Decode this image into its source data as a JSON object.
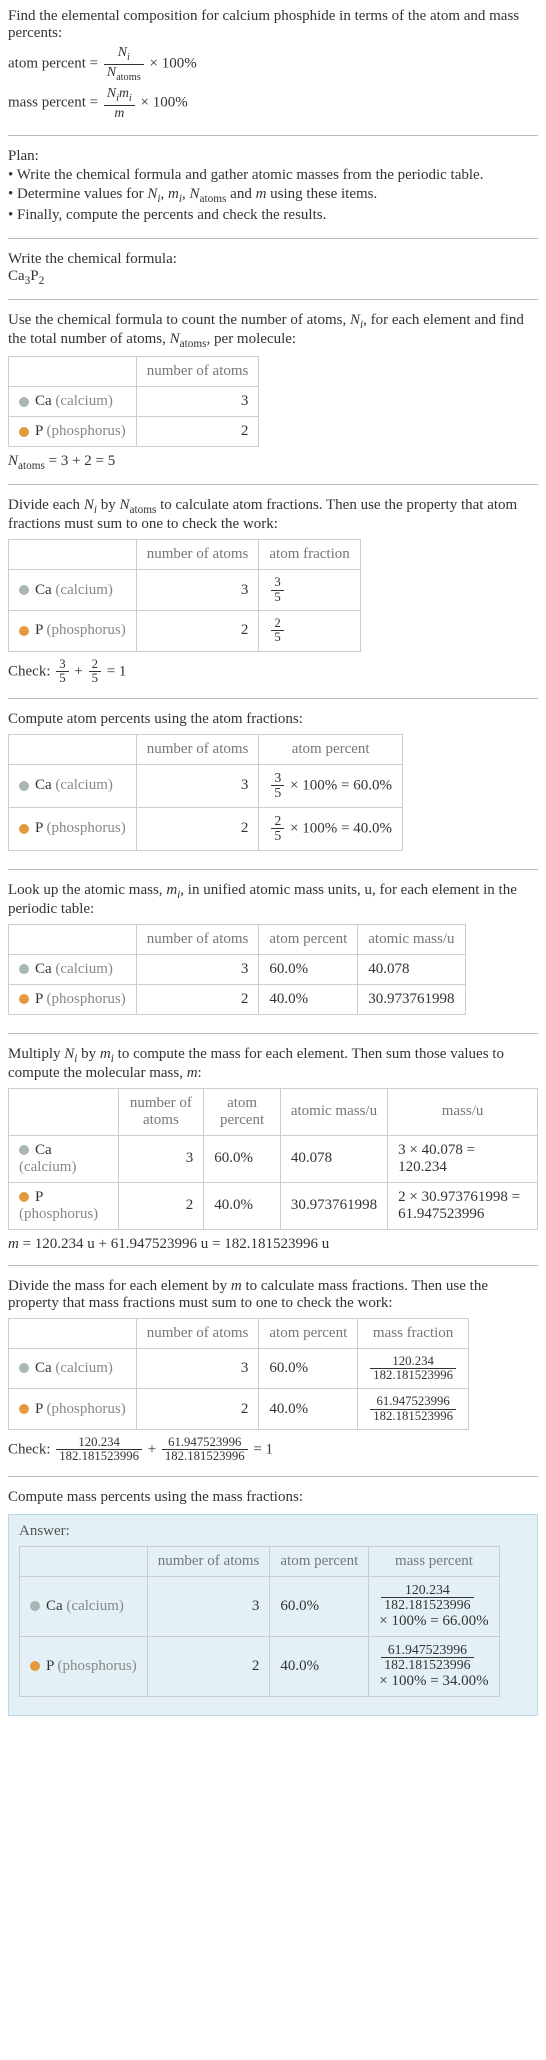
{
  "intro": {
    "line1": "Find the elemental composition for calcium phosphide in terms of the atom and mass percents:",
    "atom_percent_label": "atom percent",
    "mass_percent_label": "mass percent",
    "eq": " = ",
    "times100": " × 100%",
    "Ni": "N",
    "i": "i",
    "Natoms": "N",
    "atoms": "atoms",
    "mi": "m",
    "m": "m"
  },
  "plan": {
    "heading": "Plan:",
    "items": [
      "• Write the chemical formula and gather atomic masses from the periodic table.",
      "• Determine values for Nᵢ, mᵢ, N₍atoms₎ and m using these items.",
      "• Finally, compute the percents and check the results."
    ],
    "item2_pre": "• Determine values for ",
    "item2_mid1": ", ",
    "item2_mid2": ", ",
    "item2_mid3": " and ",
    "item2_post": " using these items."
  },
  "formula": {
    "heading": "Write the chemical formula:",
    "ca": "Ca",
    "ca_sub": "3",
    "p": "P",
    "p_sub": "2"
  },
  "count": {
    "text_pre": "Use the chemical formula to count the number of atoms, ",
    "text_mid": ", for each element and find the total number of atoms, ",
    "text_post": ", per molecule:",
    "col_num": "number of atoms",
    "ca_label": "Ca",
    "ca_paren": " (calcium)",
    "ca_n": "3",
    "p_label": "P",
    "p_paren": " (phosphorus)",
    "p_n": "2",
    "sum": " = 3 + 2 = 5"
  },
  "atomfrac": {
    "text_pre": "Divide each ",
    "text_mid": " by ",
    "text_post": " to calculate atom fractions. Then use the property that atom fractions must sum to one to check the work:",
    "col_num": "number of atoms",
    "col_frac": "atom fraction",
    "ca_n": "3",
    "ca_num": "3",
    "ca_den": "5",
    "p_n": "2",
    "p_num": "2",
    "p_den": "5",
    "check_pre": "Check: ",
    "check_mid": " + ",
    "check_post": " = 1"
  },
  "atompct": {
    "heading": "Compute atom percents using the atom fractions:",
    "col_num": "number of atoms",
    "col_pct": "atom percent",
    "ca_n": "3",
    "ca_expr_num": "3",
    "ca_expr_den": "5",
    "ca_expr_post": " × 100% = 60.0%",
    "p_n": "2",
    "p_expr_num": "2",
    "p_expr_den": "5",
    "p_expr_post": " × 100% = 40.0%"
  },
  "atomicmass": {
    "text_pre": "Look up the atomic mass, ",
    "text_post": ", in unified atomic mass units, u, for each element in the periodic table:",
    "col_num": "number of atoms",
    "col_pct": "atom percent",
    "col_mass": "atomic mass/u",
    "ca_n": "3",
    "ca_pct": "60.0%",
    "ca_mass": "40.078",
    "p_n": "2",
    "p_pct": "40.0%",
    "p_mass": "30.973761998"
  },
  "massmult": {
    "text_pre": "Multiply ",
    "text_mid": " by ",
    "text_post": " to compute the mass for each element. Then sum those values to compute the molecular mass, ",
    "col_num": "number of atoms",
    "col_pct": "atom percent",
    "col_amass": "atomic mass/u",
    "col_mass": "mass/u",
    "ca_n": "3",
    "ca_pct": "60.0%",
    "ca_amass": "40.078",
    "ca_mass": "3 × 40.078 = 120.234",
    "p_n": "2",
    "p_pct": "40.0%",
    "p_amass": "30.973761998",
    "p_mass": "2 × 30.973761998 = 61.947523996",
    "sum": " = 120.234 u + 61.947523996 u = 182.181523996 u"
  },
  "massfrac": {
    "text_pre": "Divide the mass for each element by ",
    "text_post": " to calculate mass fractions. Then use the property that mass fractions must sum to one to check the work:",
    "col_num": "number of atoms",
    "col_pct": "atom percent",
    "col_mfrac": "mass fraction",
    "ca_n": "3",
    "ca_pct": "60.0%",
    "ca_num": "120.234",
    "ca_den": "182.181523996",
    "p_n": "2",
    "p_pct": "40.0%",
    "p_num": "61.947523996",
    "p_den": "182.181523996",
    "check_pre": "Check: ",
    "check_mid": " + ",
    "check_post": " = 1"
  },
  "answer": {
    "heading": "Compute mass percents using the mass fractions:",
    "label": "Answer:",
    "col_num": "number of atoms",
    "col_pct": "atom percent",
    "col_mpct": "mass percent",
    "ca_n": "3",
    "ca_pct": "60.0%",
    "ca_num": "120.234",
    "ca_den": "182.181523996",
    "ca_post": "× 100% = 66.00%",
    "p_n": "2",
    "p_pct": "40.0%",
    "p_num": "61.947523996",
    "p_den": "182.181523996",
    "p_post": "× 100% = 34.00%"
  },
  "sym": {
    "N": "N",
    "i": "i",
    "atoms": "atoms",
    "m": "m"
  }
}
